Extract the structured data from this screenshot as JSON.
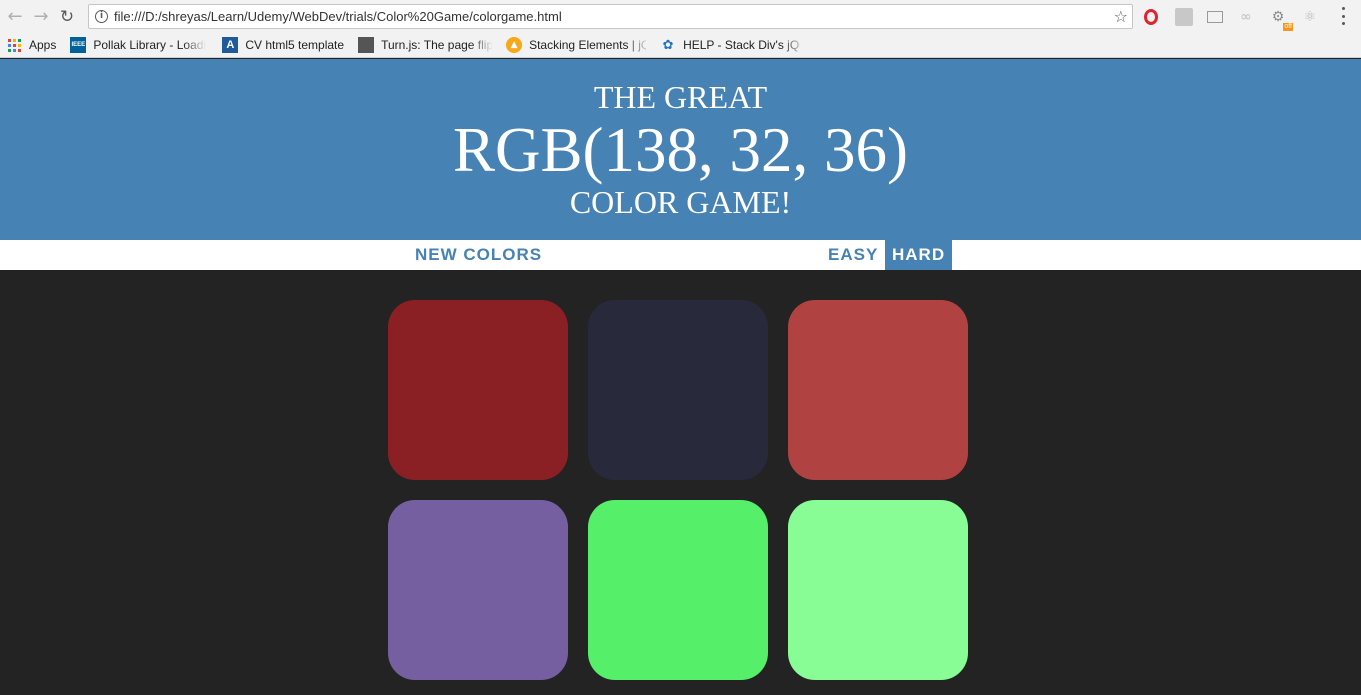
{
  "browser": {
    "url": "file:///D:/shreyas/Learn/Udemy/WebDev/trials/Color%20Game/colorgame.html",
    "extensions": [
      "opera-icon",
      "pdf-icon",
      "mail-icon",
      "password-icon",
      "gear-icon",
      "react-icon"
    ],
    "extension_badge": "off",
    "bookmarks": [
      {
        "label": "Apps",
        "icon": "apps-grid-icon"
      },
      {
        "label": "Pollak Library - Loadi",
        "icon": "ieee-icon",
        "icon_text": "IEEE"
      },
      {
        "label": "CV html5 template",
        "icon": "cv-icon",
        "icon_text": "A"
      },
      {
        "label": "Turn.js: The page flip",
        "icon": "turnjs-icon"
      },
      {
        "label": "Stacking Elements | jQ",
        "icon": "stacking-icon"
      },
      {
        "label": "HELP - Stack Div's jQu",
        "icon": "help-icon"
      }
    ]
  },
  "game": {
    "title_top": "THE GREAT",
    "title_rgb": "RGB(138, 32, 36)",
    "title_bottom": "COLOR GAME!",
    "new_colors_label": "NEW COLORS",
    "easy_label": "EASY",
    "hard_label": "HARD",
    "selected_mode": "HARD",
    "header_color": "#4682b4",
    "background_color": "#232323",
    "squares": [
      {
        "color": "#8a2024"
      },
      {
        "color": "#29293c"
      },
      {
        "color": "#b04342"
      },
      {
        "color": "#765fa0"
      },
      {
        "color": "#55ef6a"
      },
      {
        "color": "#88fd96"
      }
    ]
  }
}
